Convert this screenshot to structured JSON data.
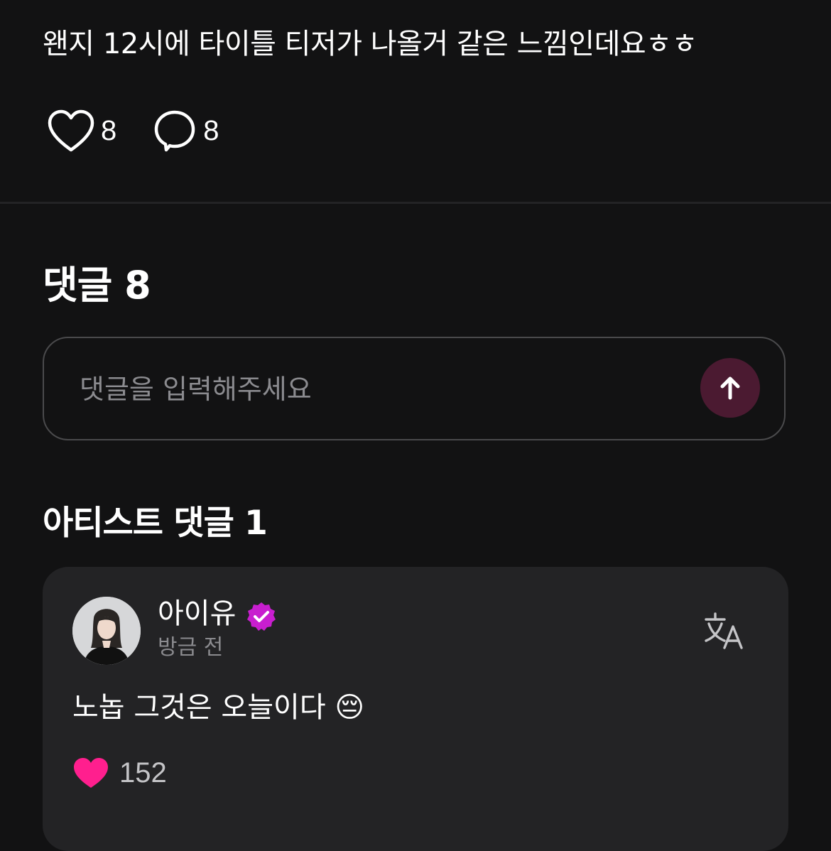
{
  "post": {
    "text": "왠지 12시에  타이틀  티저가 나올거 같은 느낌인데요ㅎㅎ",
    "like_icon": "heart-outline-icon",
    "like_count": "8",
    "comment_icon": "speech-bubble-icon",
    "comment_count": "8"
  },
  "comments_section": {
    "title": "댓글 8",
    "input_placeholder": "댓글을 입력해주세요",
    "send_icon": "arrow-up-icon"
  },
  "artist_section": {
    "title": "아티스트 댓글 1",
    "comment": {
      "author": "아이유",
      "verified_icon": "verified-badge-icon",
      "time": "방금 전",
      "translate_icon": "translate-icon",
      "text": "노놉 그것은 오늘이다 😔",
      "like_icon": "heart-filled-icon",
      "like_count": "152"
    }
  },
  "colors": {
    "background": "#121213",
    "card": "#232325",
    "accent_pink": "#ff1f8e",
    "verified_purple": "#c81ecf",
    "send_button": "#4b1a31",
    "muted_text": "#8b8b8f"
  }
}
